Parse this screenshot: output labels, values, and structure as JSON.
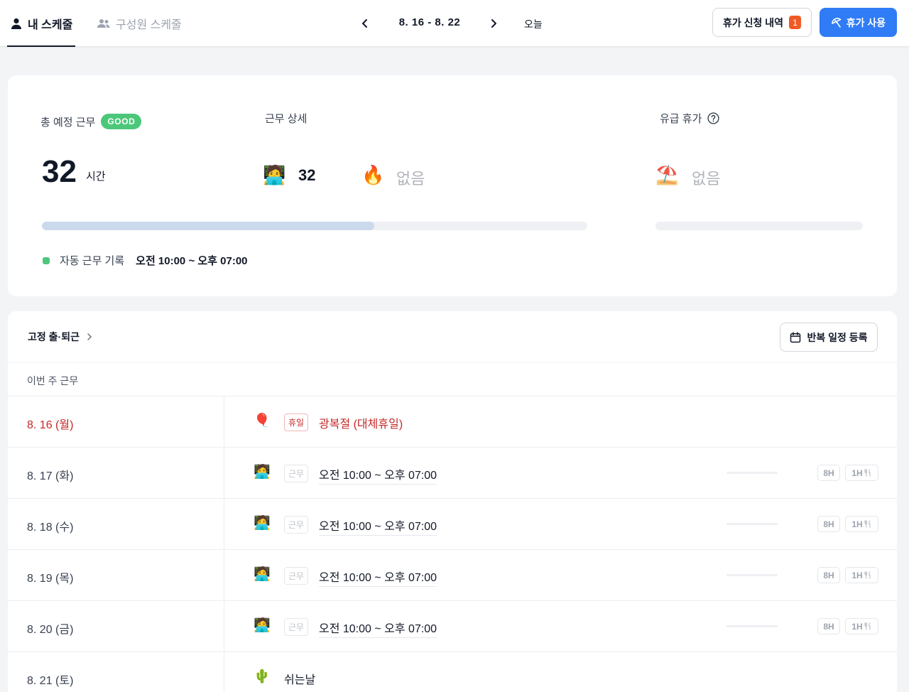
{
  "tabs": {
    "my_schedule": "내 스케줄",
    "member_schedule": "구성원 스케줄"
  },
  "date_nav": {
    "range": "8. 16 - 8. 22",
    "today": "오늘"
  },
  "actions": {
    "leave_history": "휴가 신청 내역",
    "leave_history_count": "1",
    "use_leave": "휴가 사용"
  },
  "summary": {
    "total_label": "총 예정 근무",
    "total_badge": "GOOD",
    "total_value": "32",
    "total_unit": "시간",
    "total_progress": 0.61,
    "detail_label": "근무 상세",
    "detail_work_value": "32",
    "detail_overtime_value": "없음",
    "paid_leave_label": "유급 휴가",
    "paid_leave_value": "없음",
    "paid_leave_progress": 0,
    "auto_record_label": "자동 근무 기록",
    "auto_record_time": "오전 10:00 ~ 오후 07:00",
    "status_color": "#4cc77a"
  },
  "schedule": {
    "fixed_label": "고정 출·퇴근",
    "repeat_button": "반복 일정 등록",
    "section_title": "이번 주 근무",
    "days": [
      {
        "date": "8. 16 (월)",
        "type": "holiday",
        "icon": "balloon-icon",
        "tag": "휴일",
        "text": "광복절 (대체휴일)"
      },
      {
        "date": "8. 17 (화)",
        "type": "work",
        "icon": "worker-laptop-icon",
        "tag": "근무",
        "text": "오전 10:00 ~ 오후 07:00",
        "hours": "8H",
        "meal": "1H"
      },
      {
        "date": "8. 18 (수)",
        "type": "work",
        "icon": "worker-laptop-icon",
        "tag": "근무",
        "text": "오전 10:00 ~ 오후 07:00",
        "hours": "8H",
        "meal": "1H"
      },
      {
        "date": "8. 19 (목)",
        "type": "work",
        "icon": "worker-laptop-icon",
        "tag": "근무",
        "text": "오전 10:00 ~ 오후 07:00",
        "hours": "8H",
        "meal": "1H"
      },
      {
        "date": "8. 20 (금)",
        "type": "work",
        "icon": "worker-laptop-icon",
        "tag": "근무",
        "text": "오전 10:00 ~ 오후 07:00",
        "hours": "8H",
        "meal": "1H"
      },
      {
        "date": "8. 21 (토)",
        "type": "rest",
        "icon": "cactus-icon",
        "text": "쉬는날"
      }
    ]
  },
  "colors": {
    "primary": "#2f7cf6",
    "holiday": "#c62828",
    "badge": "#ef5a24"
  }
}
